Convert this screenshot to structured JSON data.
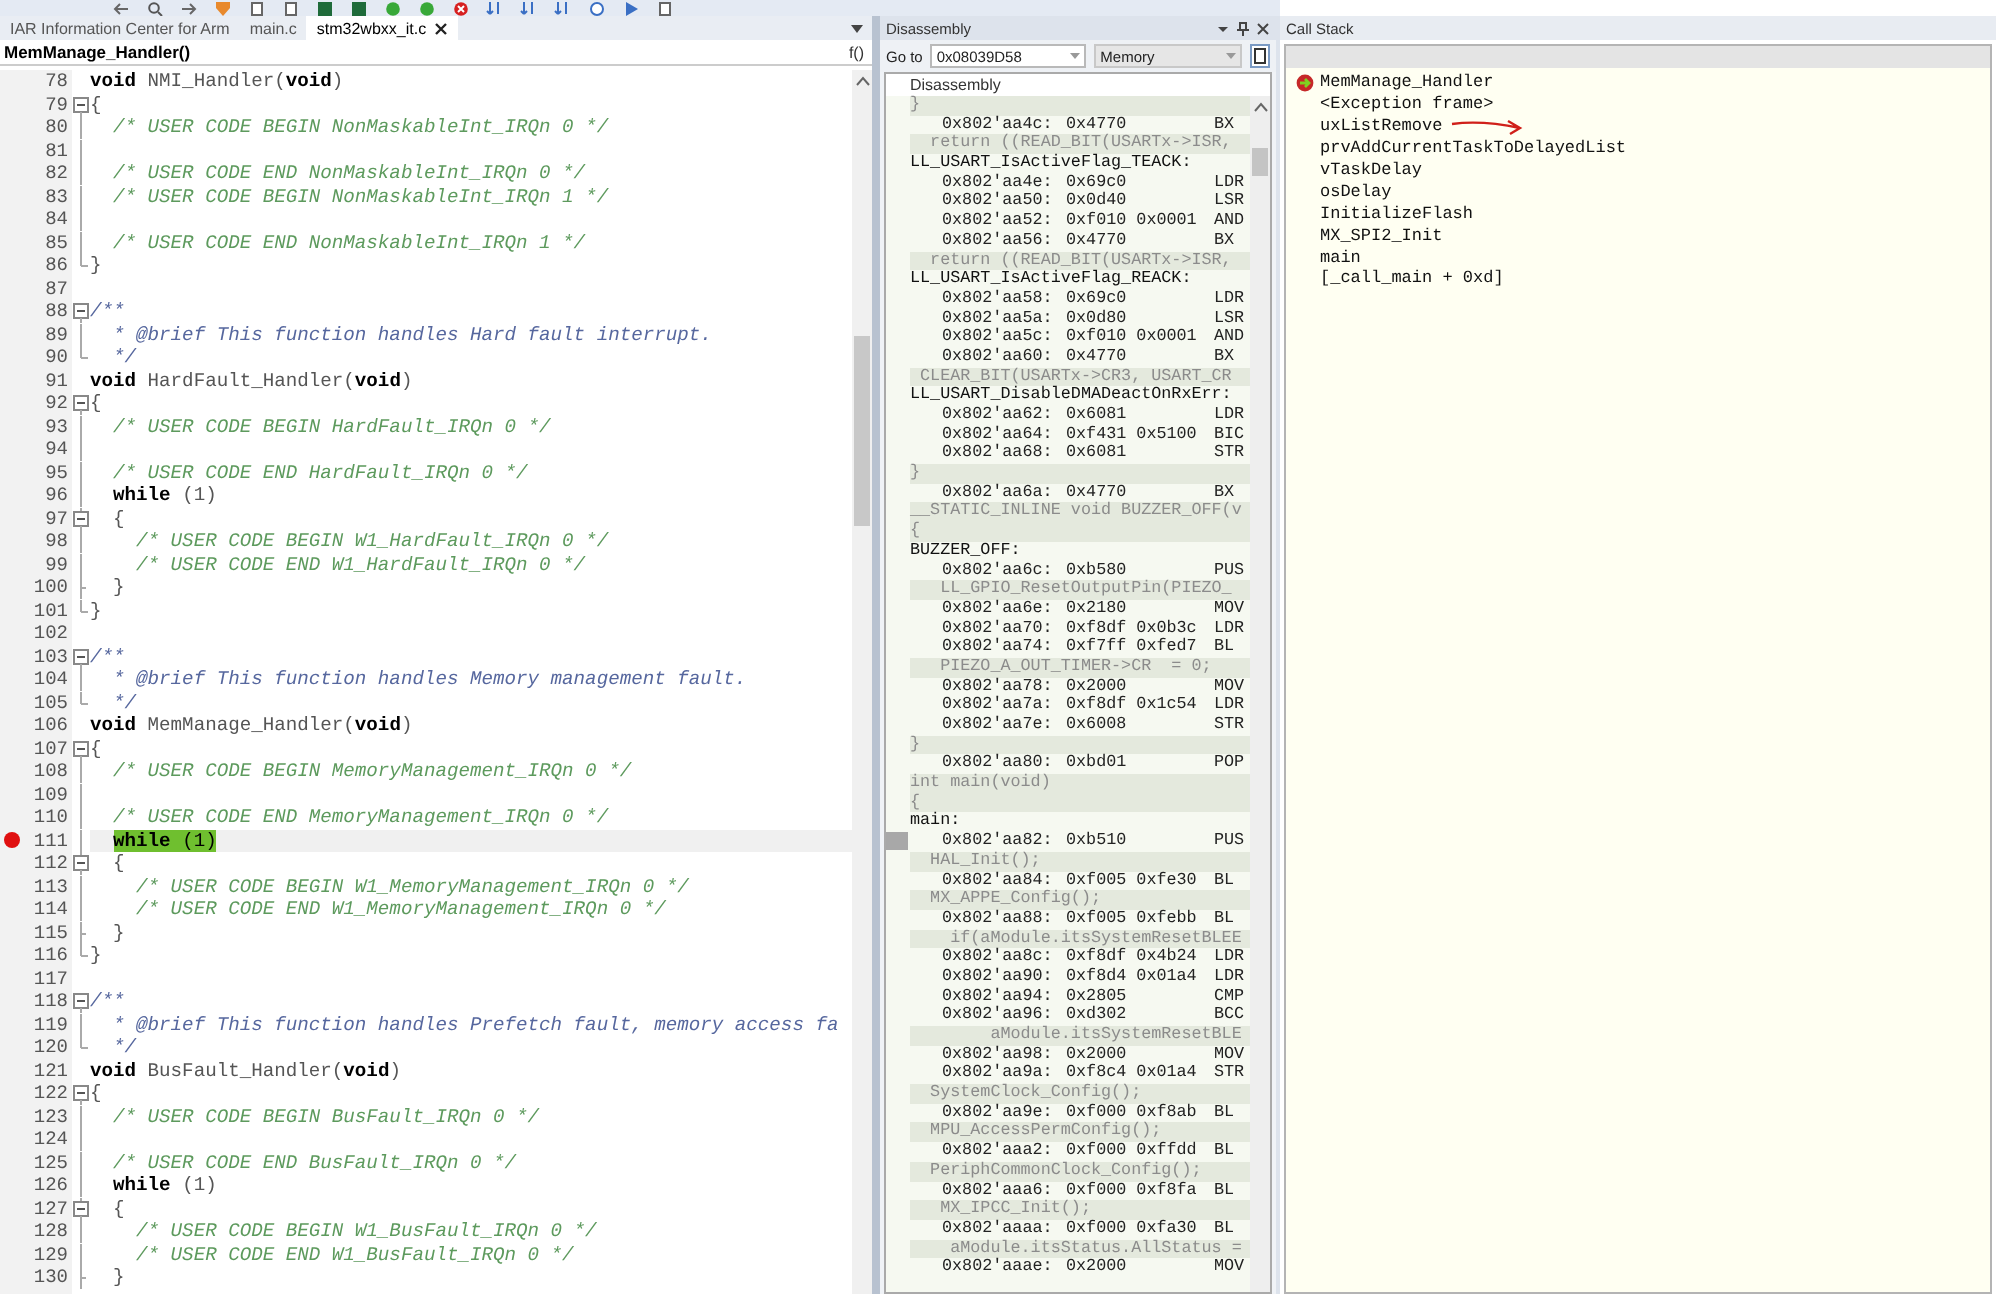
{
  "tabs": [
    {
      "label": "IAR Information Center for Arm",
      "selected": false
    },
    {
      "label": "main.c",
      "selected": false
    },
    {
      "label": "stm32wbxx_it.c",
      "selected": true
    }
  ],
  "function_bar": {
    "name": "MemManage_Handler()",
    "button_label": "f()"
  },
  "editor": {
    "lines": [
      {
        "number": "78",
        "kind": "code",
        "text": "**void** NMI_Handler(**void**)",
        "collapsible": false,
        "in_block": false,
        "block_end": false,
        "breakpoint": false,
        "current": false
      },
      {
        "number": "79",
        "kind": "code",
        "text": "{",
        "collapsible": true,
        "in_block": false,
        "block_end": false,
        "breakpoint": false,
        "current": false
      },
      {
        "number": "80",
        "kind": "comment",
        "text": "  /* USER CODE BEGIN NonMaskableInt_IRQn 0 */",
        "collapsible": false,
        "in_block": true,
        "block_end": false,
        "breakpoint": false,
        "current": false
      },
      {
        "number": "81",
        "kind": "blank",
        "collapsible": false,
        "in_block": true,
        "block_end": false,
        "breakpoint": false,
        "current": false
      },
      {
        "number": "82",
        "kind": "comment",
        "text": "  /* USER CODE END NonMaskableInt_IRQn 0 */",
        "collapsible": false,
        "in_block": true,
        "block_end": false,
        "breakpoint": false,
        "current": false
      },
      {
        "number": "83",
        "kind": "comment",
        "text": "  /* USER CODE BEGIN NonMaskableInt_IRQn 1 */",
        "collapsible": false,
        "in_block": true,
        "block_end": false,
        "breakpoint": false,
        "current": false
      },
      {
        "number": "84",
        "kind": "blank",
        "collapsible": false,
        "in_block": true,
        "block_end": false,
        "breakpoint": false,
        "current": false
      },
      {
        "number": "85",
        "kind": "comment",
        "text": "  /* USER CODE END NonMaskableInt_IRQn 1 */",
        "collapsible": false,
        "in_block": true,
        "block_end": false,
        "breakpoint": false,
        "current": false
      },
      {
        "number": "86",
        "kind": "code",
        "text": "}",
        "collapsible": false,
        "in_block": false,
        "block_end": true,
        "breakpoint": false,
        "current": false
      },
      {
        "number": "87",
        "kind": "blank",
        "collapsible": false,
        "in_block": false,
        "block_end": false,
        "breakpoint": false,
        "current": false
      },
      {
        "number": "88",
        "kind": "doc",
        "text": "/**",
        "collapsible": true,
        "in_block": false,
        "block_end": false,
        "breakpoint": false,
        "current": false
      },
      {
        "number": "89",
        "kind": "doc",
        "text": "  * @brief This function handles Hard fault interrupt.",
        "collapsible": false,
        "in_block": true,
        "block_end": false,
        "breakpoint": false,
        "current": false
      },
      {
        "number": "90",
        "kind": "doc",
        "text": "  */",
        "collapsible": false,
        "in_block": false,
        "block_end": true,
        "breakpoint": false,
        "current": false
      },
      {
        "number": "91",
        "kind": "code",
        "text": "**void** HardFault_Handler(**void**)",
        "collapsible": false,
        "in_block": false,
        "block_end": false,
        "breakpoint": false,
        "current": false
      },
      {
        "number": "92",
        "kind": "code",
        "text": "{",
        "collapsible": true,
        "in_block": false,
        "block_end": false,
        "breakpoint": false,
        "current": false
      },
      {
        "number": "93",
        "kind": "comment",
        "text": "  /* USER CODE BEGIN HardFault_IRQn 0 */",
        "collapsible": false,
        "in_block": true,
        "block_end": false,
        "breakpoint": false,
        "current": false
      },
      {
        "number": "94",
        "kind": "blank",
        "collapsible": false,
        "in_block": true,
        "block_end": false,
        "breakpoint": false,
        "current": false
      },
      {
        "number": "95",
        "kind": "comment",
        "text": "  /* USER CODE END HardFault_IRQn 0 */",
        "collapsible": false,
        "in_block": true,
        "block_end": false,
        "breakpoint": false,
        "current": false
      },
      {
        "number": "96",
        "kind": "code",
        "text": "  **while** (1)",
        "collapsible": false,
        "in_block": true,
        "block_end": false,
        "breakpoint": false,
        "current": false
      },
      {
        "number": "97",
        "kind": "code",
        "text": "  {",
        "collapsible": true,
        "in_block": true,
        "block_end": false,
        "breakpoint": false,
        "current": false
      },
      {
        "number": "98",
        "kind": "comment",
        "text": "    /* USER CODE BEGIN W1_HardFault_IRQn 0 */",
        "collapsible": false,
        "in_block": true,
        "block_end": false,
        "breakpoint": false,
        "current": false
      },
      {
        "number": "99",
        "kind": "comment",
        "text": "    /* USER CODE END W1_HardFault_IRQn 0 */",
        "collapsible": false,
        "in_block": true,
        "block_end": false,
        "breakpoint": false,
        "current": false
      },
      {
        "number": "100",
        "kind": "code",
        "text": "  }",
        "collapsible": false,
        "in_block": true,
        "block_end": true,
        "breakpoint": false,
        "current": false
      },
      {
        "number": "101",
        "kind": "code",
        "text": "}",
        "collapsible": false,
        "in_block": false,
        "block_end": true,
        "breakpoint": false,
        "current": false
      },
      {
        "number": "102",
        "kind": "blank",
        "collapsible": false,
        "in_block": false,
        "block_end": false,
        "breakpoint": false,
        "current": false
      },
      {
        "number": "103",
        "kind": "doc",
        "text": "/**",
        "collapsible": true,
        "in_block": false,
        "block_end": false,
        "breakpoint": false,
        "current": false
      },
      {
        "number": "104",
        "kind": "doc",
        "text": "  * @brief This function handles Memory management fault.",
        "collapsible": false,
        "in_block": true,
        "block_end": false,
        "breakpoint": false,
        "current": false
      },
      {
        "number": "105",
        "kind": "doc",
        "text": "  */",
        "collapsible": false,
        "in_block": false,
        "block_end": true,
        "breakpoint": false,
        "current": false
      },
      {
        "number": "106",
        "kind": "code",
        "text": "**void** MemManage_Handler(**void**)",
        "collapsible": false,
        "in_block": false,
        "block_end": false,
        "breakpoint": false,
        "current": false
      },
      {
        "number": "107",
        "kind": "code",
        "text": "{",
        "collapsible": true,
        "in_block": false,
        "block_end": false,
        "breakpoint": false,
        "current": false
      },
      {
        "number": "108",
        "kind": "comment",
        "text": "  /* USER CODE BEGIN MemoryManagement_IRQn 0 */",
        "collapsible": false,
        "in_block": true,
        "block_end": false,
        "breakpoint": false,
        "current": false
      },
      {
        "number": "109",
        "kind": "blank",
        "collapsible": false,
        "in_block": true,
        "block_end": false,
        "breakpoint": false,
        "current": false
      },
      {
        "number": "110",
        "kind": "comment",
        "text": "  /* USER CODE END MemoryManagement_IRQn 0 */",
        "collapsible": false,
        "in_block": true,
        "block_end": false,
        "breakpoint": false,
        "current": false
      },
      {
        "number": "111",
        "kind": "code",
        "text": "  **while** (1)",
        "collapsible": false,
        "in_block": true,
        "block_end": false,
        "breakpoint": true,
        "current": true
      },
      {
        "number": "112",
        "kind": "code",
        "text": "  {",
        "collapsible": true,
        "in_block": true,
        "block_end": false,
        "breakpoint": false,
        "current": false
      },
      {
        "number": "113",
        "kind": "comment",
        "text": "    /* USER CODE BEGIN W1_MemoryManagement_IRQn 0 */",
        "collapsible": false,
        "in_block": true,
        "block_end": false,
        "breakpoint": false,
        "current": false
      },
      {
        "number": "114",
        "kind": "comment",
        "text": "    /* USER CODE END W1_MemoryManagement_IRQn 0 */",
        "collapsible": false,
        "in_block": true,
        "block_end": false,
        "breakpoint": false,
        "current": false
      },
      {
        "number": "115",
        "kind": "code",
        "text": "  }",
        "collapsible": false,
        "in_block": true,
        "block_end": true,
        "breakpoint": false,
        "current": false
      },
      {
        "number": "116",
        "kind": "code",
        "text": "}",
        "collapsible": false,
        "in_block": false,
        "block_end": true,
        "breakpoint": false,
        "current": false
      },
      {
        "number": "117",
        "kind": "blank",
        "collapsible": false,
        "in_block": false,
        "block_end": false,
        "breakpoint": false,
        "current": false
      },
      {
        "number": "118",
        "kind": "doc",
        "text": "/**",
        "collapsible": true,
        "in_block": false,
        "block_end": false,
        "breakpoint": false,
        "current": false
      },
      {
        "number": "119",
        "kind": "doc",
        "text": "  * @brief This function handles Prefetch fault, memory access fa",
        "collapsible": false,
        "in_block": true,
        "block_end": false,
        "breakpoint": false,
        "current": false
      },
      {
        "number": "120",
        "kind": "doc",
        "text": "  */",
        "collapsible": false,
        "in_block": false,
        "block_end": true,
        "breakpoint": false,
        "current": false
      },
      {
        "number": "121",
        "kind": "code",
        "text": "**void** BusFault_Handler(**void**)",
        "collapsible": false,
        "in_block": false,
        "block_end": false,
        "breakpoint": false,
        "current": false
      },
      {
        "number": "122",
        "kind": "code",
        "text": "{",
        "collapsible": true,
        "in_block": false,
        "block_end": false,
        "breakpoint": false,
        "current": false
      },
      {
        "number": "123",
        "kind": "comment",
        "text": "  /* USER CODE BEGIN BusFault_IRQn 0 */",
        "collapsible": false,
        "in_block": true,
        "block_end": false,
        "breakpoint": false,
        "current": false
      },
      {
        "number": "124",
        "kind": "blank",
        "collapsible": false,
        "in_block": true,
        "block_end": false,
        "breakpoint": false,
        "current": false
      },
      {
        "number": "125",
        "kind": "comment",
        "text": "  /* USER CODE END BusFault_IRQn 0 */",
        "collapsible": false,
        "in_block": true,
        "block_end": false,
        "breakpoint": false,
        "current": false
      },
      {
        "number": "126",
        "kind": "code",
        "text": "  **while** (1)",
        "collapsible": false,
        "in_block": true,
        "block_end": false,
        "breakpoint": false,
        "current": false
      },
      {
        "number": "127",
        "kind": "code",
        "text": "  {",
        "collapsible": true,
        "in_block": true,
        "block_end": false,
        "breakpoint": false,
        "current": false
      },
      {
        "number": "128",
        "kind": "comment",
        "text": "    /* USER CODE BEGIN W1_BusFault_IRQn 0 */",
        "collapsible": false,
        "in_block": true,
        "block_end": false,
        "breakpoint": false,
        "current": false
      },
      {
        "number": "129",
        "kind": "comment",
        "text": "    /* USER CODE END W1_BusFault_IRQn 0 */",
        "collapsible": false,
        "in_block": true,
        "block_end": false,
        "breakpoint": false,
        "current": false
      },
      {
        "number": "130",
        "kind": "code",
        "text": "  }",
        "collapsible": false,
        "in_block": true,
        "block_end": true,
        "breakpoint": false,
        "current": false
      }
    ]
  },
  "disassembly": {
    "title": "Disassembly",
    "goto_label": "Go to",
    "goto_value": "0x08039D58",
    "memory_dropdown": "Memory",
    "column_header": "Disassembly",
    "rows": [
      {
        "kind": "source",
        "text": "}",
        "current": false
      },
      {
        "kind": "instr",
        "address": "0x802'aa4c:",
        "code": "0x4770",
        "mnemonic": "BX",
        "current": false
      },
      {
        "kind": "source",
        "text": "  return ((READ_BIT(USARTx->ISR,",
        "current": false
      },
      {
        "kind": "label",
        "text": "LL_USART_IsActiveFlag_TEACK:",
        "current": false
      },
      {
        "kind": "instr",
        "address": "0x802'aa4e:",
        "code": "0x69c0",
        "mnemonic": "LDR",
        "current": false
      },
      {
        "kind": "instr",
        "address": "0x802'aa50:",
        "code": "0x0d40",
        "mnemonic": "LSR",
        "current": false
      },
      {
        "kind": "instr",
        "address": "0x802'aa52:",
        "code": "0xf010 0x0001",
        "mnemonic": "AND",
        "current": false
      },
      {
        "kind": "instr",
        "address": "0x802'aa56:",
        "code": "0x4770",
        "mnemonic": "BX",
        "current": false
      },
      {
        "kind": "source",
        "text": "  return ((READ_BIT(USARTx->ISR,",
        "current": false
      },
      {
        "kind": "label",
        "text": "LL_USART_IsActiveFlag_REACK:",
        "current": false
      },
      {
        "kind": "instr",
        "address": "0x802'aa58:",
        "code": "0x69c0",
        "mnemonic": "LDR",
        "current": false
      },
      {
        "kind": "instr",
        "address": "0x802'aa5a:",
        "code": "0x0d80",
        "mnemonic": "LSR",
        "current": false
      },
      {
        "kind": "instr",
        "address": "0x802'aa5c:",
        "code": "0xf010 0x0001",
        "mnemonic": "AND",
        "current": false
      },
      {
        "kind": "instr",
        "address": "0x802'aa60:",
        "code": "0x4770",
        "mnemonic": "BX",
        "current": false
      },
      {
        "kind": "source",
        "text": " CLEAR_BIT(USARTx->CR3, USART_CR",
        "current": false
      },
      {
        "kind": "label",
        "text": "LL_USART_DisableDMADeactOnRxErr:",
        "current": false
      },
      {
        "kind": "instr",
        "address": "0x802'aa62:",
        "code": "0x6081",
        "mnemonic": "LDR",
        "current": false
      },
      {
        "kind": "instr",
        "address": "0x802'aa64:",
        "code": "0xf431 0x5100",
        "mnemonic": "BIC",
        "current": false
      },
      {
        "kind": "instr",
        "address": "0x802'aa68:",
        "code": "0x6081",
        "mnemonic": "STR",
        "current": false
      },
      {
        "kind": "source",
        "text": "}",
        "current": false
      },
      {
        "kind": "instr",
        "address": "0x802'aa6a:",
        "code": "0x4770",
        "mnemonic": "BX",
        "current": false
      },
      {
        "kind": "source",
        "text": "__STATIC_INLINE void BUZZER_OFF(v",
        "current": false
      },
      {
        "kind": "source",
        "text": "{",
        "current": false
      },
      {
        "kind": "label",
        "text": "BUZZER_OFF:",
        "current": false
      },
      {
        "kind": "instr",
        "address": "0x802'aa6c:",
        "code": "0xb580",
        "mnemonic": "PUS",
        "current": false
      },
      {
        "kind": "source",
        "text": "   LL_GPIO_ResetOutputPin(PIEZO_",
        "current": false
      },
      {
        "kind": "instr",
        "address": "0x802'aa6e:",
        "code": "0x2180",
        "mnemonic": "MOV",
        "current": false
      },
      {
        "kind": "instr",
        "address": "0x802'aa70:",
        "code": "0xf8df 0x0b3c",
        "mnemonic": "LDR",
        "current": false
      },
      {
        "kind": "instr",
        "address": "0x802'aa74:",
        "code": "0xf7ff 0xfed7",
        "mnemonic": "BL",
        "current": false
      },
      {
        "kind": "source",
        "text": "   PIEZO_A_OUT_TIMER->CR  = 0;",
        "current": false
      },
      {
        "kind": "instr",
        "address": "0x802'aa78:",
        "code": "0x2000",
        "mnemonic": "MOV",
        "current": false
      },
      {
        "kind": "instr",
        "address": "0x802'aa7a:",
        "code": "0xf8df 0x1c54",
        "mnemonic": "LDR",
        "current": false
      },
      {
        "kind": "instr",
        "address": "0x802'aa7e:",
        "code": "0x6008",
        "mnemonic": "STR",
        "current": false
      },
      {
        "kind": "source",
        "text": "}",
        "current": false
      },
      {
        "kind": "instr",
        "address": "0x802'aa80:",
        "code": "0xbd01",
        "mnemonic": "POP",
        "current": false
      },
      {
        "kind": "source",
        "text": "int main(void)",
        "current": false
      },
      {
        "kind": "source",
        "text": "{",
        "current": false
      },
      {
        "kind": "label",
        "text": "main:",
        "current": false
      },
      {
        "kind": "instr",
        "address": "0x802'aa82:",
        "code": "0xb510",
        "mnemonic": "PUS",
        "current": true
      },
      {
        "kind": "source",
        "text": "  HAL_Init();",
        "current": false
      },
      {
        "kind": "instr",
        "address": "0x802'aa84:",
        "code": "0xf005 0xfe30",
        "mnemonic": "BL",
        "current": false
      },
      {
        "kind": "source",
        "text": "  MX_APPE_Config();",
        "current": false
      },
      {
        "kind": "instr",
        "address": "0x802'aa88:",
        "code": "0xf005 0xfebb",
        "mnemonic": "BL",
        "current": false
      },
      {
        "kind": "source",
        "text": "    if(aModule.itsSystemResetBLEE",
        "current": false
      },
      {
        "kind": "instr",
        "address": "0x802'aa8c:",
        "code": "0xf8df 0x4b24",
        "mnemonic": "LDR",
        "current": false
      },
      {
        "kind": "instr",
        "address": "0x802'aa90:",
        "code": "0xf8d4 0x01a4",
        "mnemonic": "LDR",
        "current": false
      },
      {
        "kind": "instr",
        "address": "0x802'aa94:",
        "code": "0x2805",
        "mnemonic": "CMP",
        "current": false
      },
      {
        "kind": "instr",
        "address": "0x802'aa96:",
        "code": "0xd302",
        "mnemonic": "BCC",
        "current": false
      },
      {
        "kind": "source",
        "text": "        aModule.itsSystemResetBLE",
        "current": false
      },
      {
        "kind": "instr",
        "address": "0x802'aa98:",
        "code": "0x2000",
        "mnemonic": "MOV",
        "current": false
      },
      {
        "kind": "instr",
        "address": "0x802'aa9a:",
        "code": "0xf8c4 0x01a4",
        "mnemonic": "STR",
        "current": false
      },
      {
        "kind": "source",
        "text": "  SystemClock_Config();",
        "current": false
      },
      {
        "kind": "instr",
        "address": "0x802'aa9e:",
        "code": "0xf000 0xf8ab",
        "mnemonic": "BL",
        "current": false
      },
      {
        "kind": "source",
        "text": "  MPU_AccessPermConfig();",
        "current": false
      },
      {
        "kind": "instr",
        "address": "0x802'aaa2:",
        "code": "0xf000 0xffdd",
        "mnemonic": "BL",
        "current": false
      },
      {
        "kind": "source",
        "text": "  PeriphCommonClock_Config();",
        "current": false
      },
      {
        "kind": "instr",
        "address": "0x802'aaa6:",
        "code": "0xf000 0xf8fa",
        "mnemonic": "BL",
        "current": false
      },
      {
        "kind": "source",
        "text": "   MX_IPCC_Init();",
        "current": false
      },
      {
        "kind": "instr",
        "address": "0x802'aaaa:",
        "code": "0xf000 0xfa30",
        "mnemonic": "BL",
        "current": false
      },
      {
        "kind": "source",
        "text": "    aModule.itsStatus.AllStatus =",
        "current": false
      },
      {
        "kind": "instr",
        "address": "0x802'aaae:",
        "code": "0x2000",
        "mnemonic": "MOV",
        "current": false
      }
    ]
  },
  "call_stack": {
    "title": "Call Stack",
    "items": [
      {
        "label": "MemManage_Handler",
        "current": true,
        "annotated": false
      },
      {
        "label": "<Exception frame>",
        "current": false,
        "annotated": false
      },
      {
        "label": "uxListRemove",
        "current": false,
        "annotated": true
      },
      {
        "label": "prvAddCurrentTaskToDelayedList",
        "current": false,
        "annotated": false
      },
      {
        "label": "vTaskDelay",
        "current": false,
        "annotated": false
      },
      {
        "label": "osDelay",
        "current": false,
        "annotated": false
      },
      {
        "label": "InitializeFlash",
        "current": false,
        "annotated": false
      },
      {
        "label": "MX_SPI2_Init",
        "current": false,
        "annotated": false
      },
      {
        "label": "main",
        "current": false,
        "annotated": false
      },
      {
        "label": "[_call_main + 0xd]",
        "current": false,
        "annotated": false
      }
    ]
  }
}
